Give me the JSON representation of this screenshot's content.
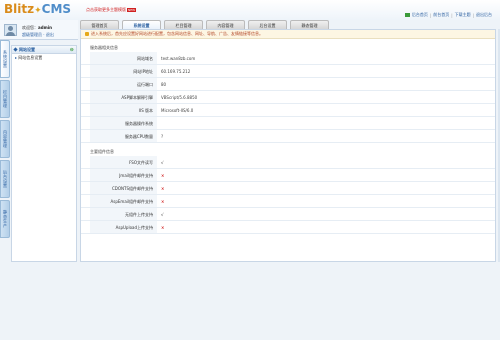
{
  "logo": {
    "part1": "Blitz",
    "dot": "✦",
    "part2": "CMS"
  },
  "promo": {
    "text": "点击获取更多主题模版",
    "badge": "NEW"
  },
  "toplinks": [
    "后台首页",
    "前台首页",
    "下载主题",
    "退出后台"
  ],
  "tabs": [
    {
      "label": "管理首页",
      "active": false
    },
    {
      "label": "系统设置",
      "active": true
    },
    {
      "label": "栏目管理",
      "active": false
    },
    {
      "label": "内容管理",
      "active": false
    },
    {
      "label": "后台设置",
      "active": false
    },
    {
      "label": "静态管理",
      "active": false
    }
  ],
  "user": {
    "welcome_prefix": "欢迎您：",
    "name": "admin",
    "role": "超级管理员",
    "sep": " · ",
    "logout": "退出"
  },
  "vnav": [
    "系统设置",
    "栏目管理",
    "内容管理",
    "后台设置",
    "静态生产"
  ],
  "sidebar": {
    "header": "网站设置",
    "collapse_icon": "⊖",
    "items": [
      {
        "arrow": "▸",
        "label": "网站信息设置"
      }
    ]
  },
  "notice": {
    "text": "进入系统后，首先应设置好网站进行配置，包含网站信息、网址、导航、广告、友情链接等信息。"
  },
  "sections": {
    "server_title": "服务器相关信息",
    "component_title": "主要组件信息"
  },
  "server_rows": [
    {
      "label": "网站域名",
      "value": "test.wan8zb.com"
    },
    {
      "label": "网站IP地址",
      "value": "60.169.75.212"
    },
    {
      "label": "运行端口",
      "value": "80"
    },
    {
      "label": "ASP脚本解释引擎",
      "value": "VBScript/5.6.8850"
    },
    {
      "label": "IIS 版本",
      "value": "Microsoft-IIS/6.0"
    },
    {
      "label": "服务器操作系统",
      "value": ""
    },
    {
      "label": "服务器CPU数量",
      "value": "?"
    }
  ],
  "component_rows": [
    {
      "label": "FSO文件读写",
      "value": "√",
      "ok": true
    },
    {
      "label": "Jmail组件邮件支持",
      "value": "×",
      "ok": false
    },
    {
      "label": "CDONTS组件邮件支持",
      "value": "×",
      "ok": false
    },
    {
      "label": "AspEmail组件邮件支持",
      "value": "×",
      "ok": false
    },
    {
      "label": "无组件上传支持",
      "value": "√",
      "ok": true
    },
    {
      "label": "AspUpload上传支持",
      "value": "×",
      "ok": false
    }
  ]
}
